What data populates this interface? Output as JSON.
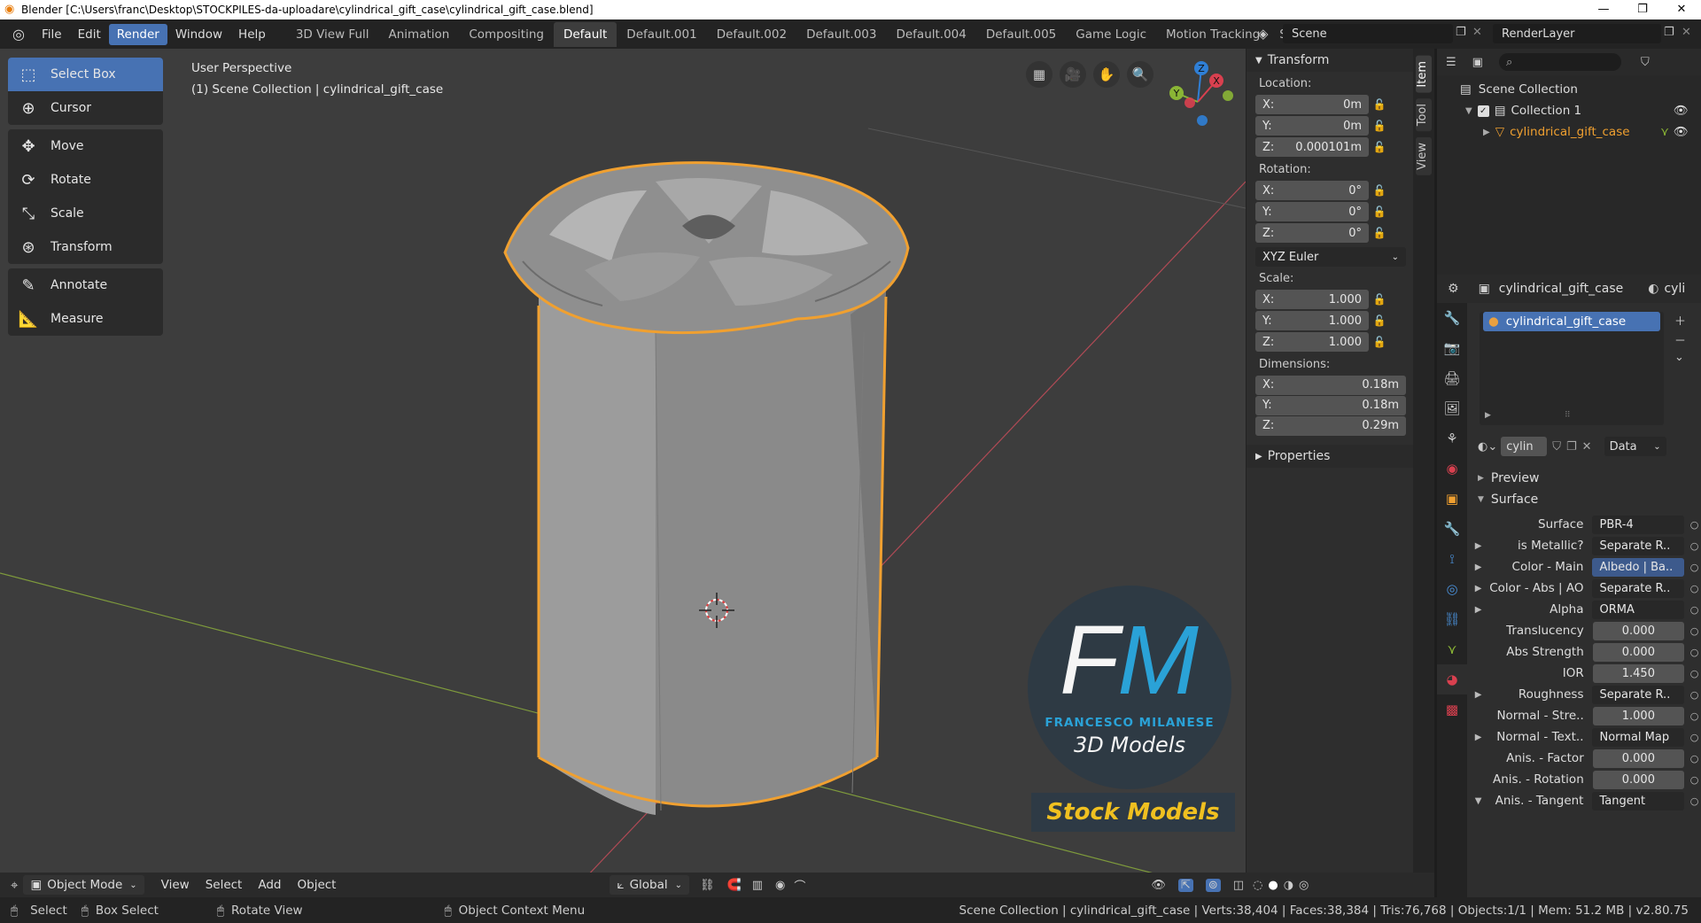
{
  "window": {
    "title": "Blender [C:\\Users\\franc\\Desktop\\STOCKPILES-da-uploadare\\cylindrical_gift_case\\cylindrical_gift_case.blend]"
  },
  "menus": [
    "File",
    "Edit",
    "Render",
    "Window",
    "Help"
  ],
  "active_menu": "Render",
  "workspaces": [
    "3D View Full",
    "Animation",
    "Compositing",
    "Default",
    "Default.001",
    "Default.002",
    "Default.003",
    "Default.004",
    "Default.005",
    "Game Logic",
    "Motion Tracking",
    "Scriptin"
  ],
  "active_workspace": "Default",
  "scene": "Scene",
  "render_layer": "RenderLayer",
  "tools": [
    [
      "Select Box",
      "Cursor"
    ],
    [
      "Move",
      "Rotate",
      "Scale",
      "Transform"
    ],
    [
      "Annotate",
      "Measure"
    ]
  ],
  "viewport": {
    "perspective": "User Perspective",
    "collection": "(1) Scene Collection | cylindrical_gift_case"
  },
  "transform": {
    "title": "Transform",
    "location_label": "Location:",
    "location": [
      "0m",
      "0m",
      "0.000101m"
    ],
    "rotation_label": "Rotation:",
    "rotation": [
      "0°",
      "0°",
      "0°"
    ],
    "rotation_mode": "XYZ Euler",
    "scale_label": "Scale:",
    "scale": [
      "1.000",
      "1.000",
      "1.000"
    ],
    "dimensions_label": "Dimensions:",
    "dimensions": [
      "0.18m",
      "0.18m",
      "0.29m"
    ],
    "axes": [
      "X:",
      "Y:",
      "Z:"
    ]
  },
  "properties_panel": "Properties",
  "ntabs": [
    "Item",
    "Tool",
    "View"
  ],
  "gizmo": {
    "x": "X",
    "y": "Y",
    "z": "Z"
  },
  "watermark": {
    "initials_f": "F",
    "initials_m": "M",
    "name": "FRANCESCO MILANESE",
    "tagline": "3D Models",
    "banner": "Stock Models"
  },
  "header3d": {
    "mode": "Object Mode",
    "menus": [
      "View",
      "Select",
      "Add",
      "Object"
    ],
    "orientation": "Global"
  },
  "statusbar": {
    "select": "Select",
    "box_select": "Box Select",
    "rotate": "Rotate View",
    "context": "Object Context Menu",
    "stats": "Scene Collection | cylindrical_gift_case | Verts:38,404 | Faces:38,384 | Tris:76,768 | Objects:1/1 | Mem: 51.2 MB | v2.80.75"
  },
  "outliner": {
    "root": "Scene Collection",
    "collection": "Collection 1",
    "object": "cylindrical_gift_case"
  },
  "props": {
    "object": "cylindrical_gift_case",
    "tab_cut": "cyli",
    "slot": "cylindrical_gift_case",
    "mat_name": "cylin",
    "data": "Data",
    "preview": "Preview",
    "surface_section": "Surface",
    "rows": [
      {
        "label": "Surface",
        "value": "PBR-4",
        "type": "sel",
        "arrow": false
      },
      {
        "label": "is Metallic?",
        "value": "Separate R..",
        "type": "sel",
        "arrow": true
      },
      {
        "label": "Color - Main",
        "value": "Albedo | Ba..",
        "type": "blue",
        "arrow": true
      },
      {
        "label": "Color - Abs | AO",
        "value": "Separate R..",
        "type": "sel",
        "arrow": true
      },
      {
        "label": "Alpha",
        "value": "ORMA",
        "type": "sel",
        "arrow": true
      },
      {
        "label": "Translucency",
        "value": "0.000",
        "type": "num",
        "arrow": false
      },
      {
        "label": "Abs Strength",
        "value": "0.000",
        "type": "num",
        "arrow": false
      },
      {
        "label": "IOR",
        "value": "1.450",
        "type": "num",
        "arrow": false
      },
      {
        "label": "Roughness",
        "value": "Separate R..",
        "type": "sel",
        "arrow": true
      },
      {
        "label": "Normal - Stre..",
        "value": "1.000",
        "type": "num",
        "arrow": false
      },
      {
        "label": "Normal - Text..",
        "value": "Normal Map",
        "type": "sel",
        "arrow": true
      },
      {
        "label": "Anis. - Factor",
        "value": "0.000",
        "type": "num",
        "arrow": false
      },
      {
        "label": "Anis. - Rotation",
        "value": "0.000",
        "type": "num",
        "arrow": false
      },
      {
        "label": "Anis. - Tangent",
        "value": "Tangent",
        "type": "sel",
        "arrow": true
      }
    ]
  },
  "colors": {
    "accent": "#4772b3",
    "selection": "#f0a030",
    "viewport_bg": "#3d3d3d",
    "x_axis": "#d9404f",
    "y_axis": "#8ab535",
    "z_axis": "#2f7fd6"
  }
}
